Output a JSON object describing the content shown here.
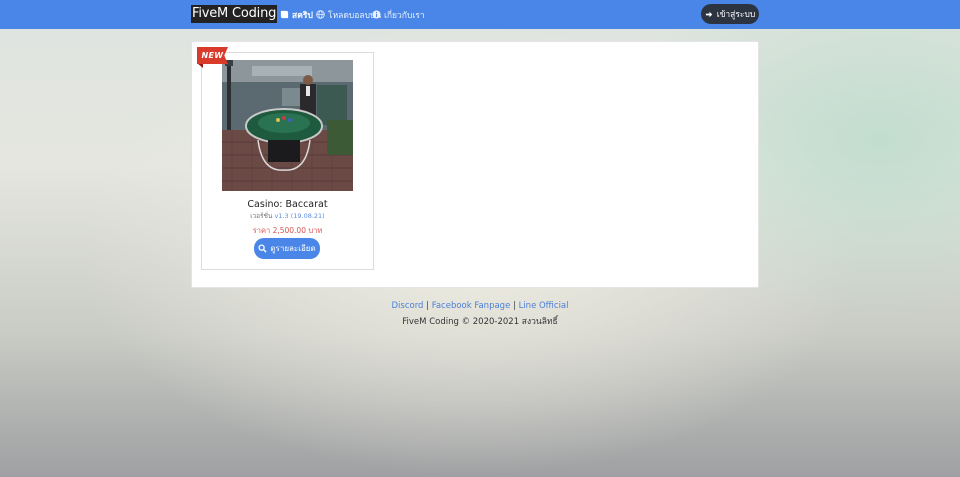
{
  "navbar": {
    "brand": "FiveM Coding",
    "items": [
      {
        "label": "สคริป",
        "icon": "scroll-icon",
        "active": true
      },
      {
        "label": "โหลดบอลบบน",
        "icon": "globe-icon",
        "active": false
      },
      {
        "label": "เกี่ยวกับเรา",
        "icon": "info-icon",
        "active": false
      }
    ],
    "login_label": "เข้าสู่ระบบ"
  },
  "products": [
    {
      "badge": "NEW",
      "title": "Casino: Baccarat",
      "version_prefix": "เวอร์ชั่น",
      "version": "v1.3 (19.08.21)",
      "price": "ราคา 2,500.00 บาท",
      "detail_label": "ดูรายละเอียด"
    }
  ],
  "footer": {
    "links": [
      "Discord",
      "Facebook Fanpage",
      "Line Official"
    ],
    "separator": "|",
    "copyright": "FiveM Coding © 2020-2021 สงวนลิทธิ์"
  },
  "colors": {
    "navbar": "#4a86e8",
    "login_button": "#2b3440",
    "price": "#d9534f",
    "ribbon": "#d83a2c",
    "link": "#4a7fd8"
  }
}
